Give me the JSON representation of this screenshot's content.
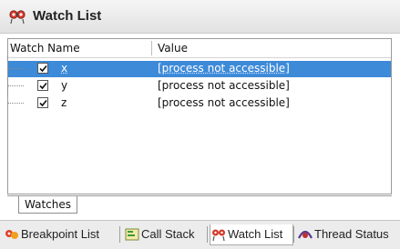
{
  "window": {
    "title": "Watch List",
    "icon": "watch-list-icon"
  },
  "table": {
    "columns": [
      "Watch Name",
      "Value"
    ],
    "rows": [
      {
        "name": "x",
        "value": "[process not accessible]",
        "checked": true,
        "selected": true
      },
      {
        "name": "y",
        "value": "[process not accessible]",
        "checked": true,
        "selected": false
      },
      {
        "name": "z",
        "value": "[process not accessible]",
        "checked": true,
        "selected": false
      }
    ]
  },
  "inner_tab": {
    "label": "Watches"
  },
  "bottom_tabs": [
    {
      "label": "Breakpoint List",
      "icon": "breakpoint-icon",
      "active": false
    },
    {
      "label": "Call Stack",
      "icon": "call-stack-icon",
      "active": false
    },
    {
      "label": "Watch List",
      "icon": "watch-list-icon",
      "active": true
    },
    {
      "label": "Thread Status",
      "icon": "thread-status-icon",
      "active": false
    }
  ],
  "colors": {
    "selection": "#3d8ad8",
    "titlebar": "#e8e8e8"
  }
}
